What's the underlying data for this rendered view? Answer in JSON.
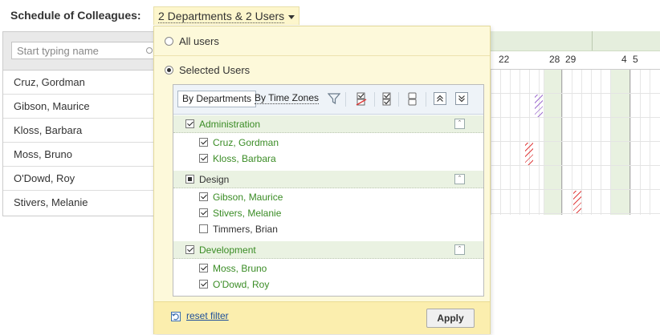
{
  "header": {
    "title": "Schedule of Colleagues:",
    "filter_label": "2 Departments & 2 Users"
  },
  "search": {
    "placeholder": "Start typing name"
  },
  "colleagues": [
    "Cruz, Gordman",
    "Gibson, Maurice",
    "Kloss, Barbara",
    "Moss, Bruno",
    "O'Dowd, Roy",
    "Stivers, Melanie"
  ],
  "calendar": {
    "days": [
      "22",
      "28",
      "29",
      "4",
      "5"
    ]
  },
  "popup": {
    "options": {
      "all_users": "All users",
      "selected_users": "Selected Users",
      "selected": "selected_users"
    },
    "toolbar": {
      "by_departments": "By Departments",
      "by_time_zones": "By Time Zones"
    },
    "groups": [
      {
        "name": "Administration",
        "state": "checked",
        "members": [
          {
            "name": "Cruz, Gordman",
            "checked": true
          },
          {
            "name": "Kloss, Barbara",
            "checked": true
          }
        ]
      },
      {
        "name": "Design",
        "state": "partial",
        "members": [
          {
            "name": "Gibson, Maurice",
            "checked": true
          },
          {
            "name": "Stivers, Melanie",
            "checked": true
          },
          {
            "name": "Timmers, Brian",
            "checked": false
          }
        ]
      },
      {
        "name": "Development",
        "state": "checked",
        "members": [
          {
            "name": "Moss, Bruno",
            "checked": true
          },
          {
            "name": "O'Dowd, Roy",
            "checked": true
          }
        ]
      }
    ],
    "footer": {
      "reset_label": "reset filter",
      "apply_label": "Apply"
    }
  },
  "colors": {
    "selected_text": "#3a8c25",
    "group_bg": "#eaf2e2",
    "popup_bg": "#fdf9da",
    "footer_bg": "#fbeeae",
    "link": "#1d4e9a"
  }
}
